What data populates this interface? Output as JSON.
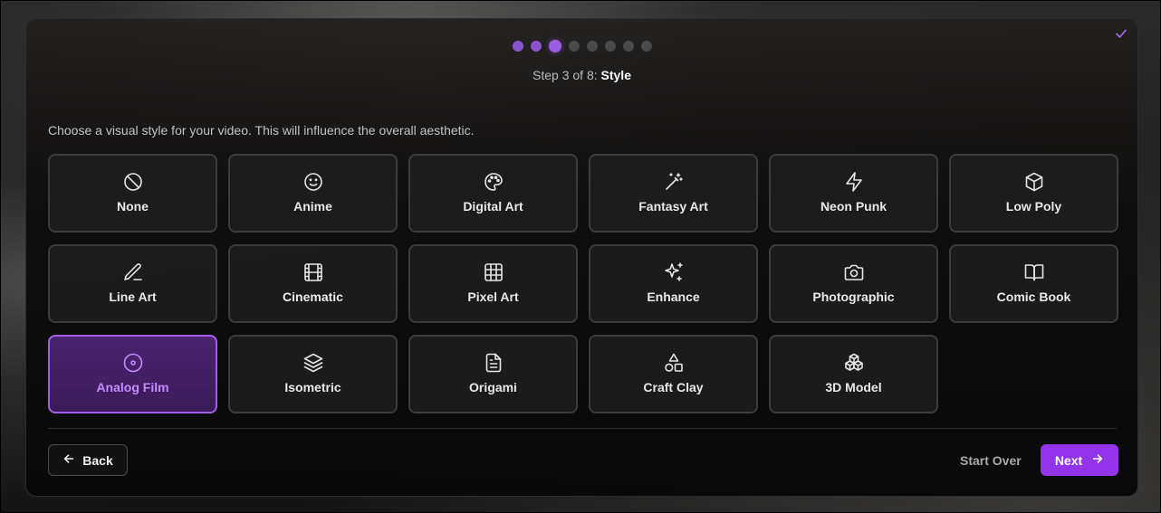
{
  "stepper": {
    "total": 8,
    "current": 3,
    "prefix": "Step 3 of 8:",
    "name": "Style"
  },
  "description": "Choose a visual style for your video. This will influence the overall aesthetic.",
  "styles": [
    {
      "label": "None",
      "icon": "ban-icon",
      "selected": false
    },
    {
      "label": "Anime",
      "icon": "smile-icon",
      "selected": false
    },
    {
      "label": "Digital Art",
      "icon": "palette-icon",
      "selected": false
    },
    {
      "label": "Fantasy Art",
      "icon": "magic-wand-icon",
      "selected": false
    },
    {
      "label": "Neon Punk",
      "icon": "lightning-icon",
      "selected": false
    },
    {
      "label": "Low Poly",
      "icon": "cube-icon",
      "selected": false
    },
    {
      "label": "Line Art",
      "icon": "pen-line-icon",
      "selected": false
    },
    {
      "label": "Cinematic",
      "icon": "film-icon",
      "selected": false
    },
    {
      "label": "Pixel Art",
      "icon": "grid-icon",
      "selected": false
    },
    {
      "label": "Enhance",
      "icon": "sparkles-icon",
      "selected": false
    },
    {
      "label": "Photographic",
      "icon": "camera-icon",
      "selected": false
    },
    {
      "label": "Comic Book",
      "icon": "book-open-icon",
      "selected": false
    },
    {
      "label": "Analog Film",
      "icon": "disc-icon",
      "selected": true
    },
    {
      "label": "Isometric",
      "icon": "layers-icon",
      "selected": false
    },
    {
      "label": "Origami",
      "icon": "file-text-icon",
      "selected": false
    },
    {
      "label": "Craft Clay",
      "icon": "shapes-icon",
      "selected": false
    },
    {
      "label": "3D Model",
      "icon": "boxes-icon",
      "selected": false
    }
  ],
  "footer": {
    "back_label": "Back",
    "start_over_label": "Start Over",
    "next_label": "Next"
  },
  "colors": {
    "accent": "#9333ea",
    "selected_border": "#a35ee8",
    "selected_text": "#c48bff"
  }
}
